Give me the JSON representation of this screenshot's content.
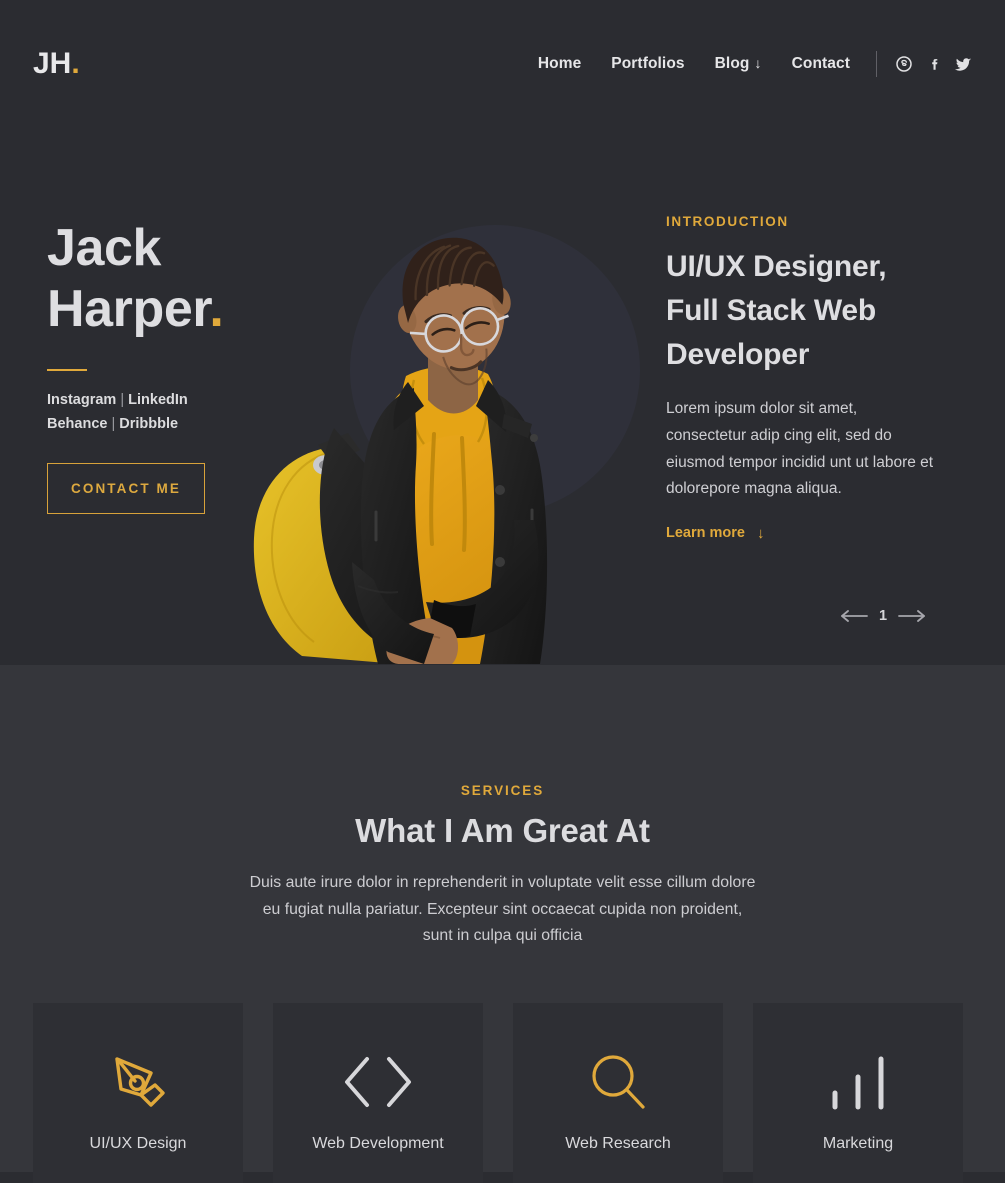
{
  "colors": {
    "accent": "#e0a93b",
    "hero_bg": "#2b2c31",
    "services_bg": "#35363b",
    "card_bg": "#2e2f34",
    "text_light": "#dedee1",
    "text_muted": "#cfcfd3"
  },
  "navbar": {
    "logo_text": "JH",
    "logo_dot": ".",
    "links": [
      {
        "label": "Home",
        "caret": ""
      },
      {
        "label": "Portfolios",
        "caret": ""
      },
      {
        "label": "Blog",
        "caret": "↓"
      },
      {
        "label": "Contact",
        "caret": ""
      }
    ],
    "social": [
      {
        "name": "skype-icon",
        "title": "Skype"
      },
      {
        "name": "facebook-icon",
        "title": "Facebook"
      },
      {
        "name": "twitter-icon",
        "title": "Twitter"
      }
    ]
  },
  "hero": {
    "name_line1": "Jack",
    "name_line2": "Harper",
    "name_dot": ".",
    "social_line1": "Instagram",
    "social_sep1": " | ",
    "social_line1b": "LinkedIn",
    "social_line2": "Behance",
    "social_sep2": " | ",
    "social_line2b": "Dribbble",
    "contact_button": "CONTACT ME",
    "eyebrow": "INTRODUCTION",
    "title": "UI/UX Designer, Full Stack Web Developer",
    "description": "Lorem ipsum dolor sit amet, consectetur adip cing elit, sed do eiusmod tempor incidid unt ut labore et dolorepore magna aliqua.",
    "learn_more": "Learn more",
    "learn_more_arrow": "↓",
    "slide_index": "1"
  },
  "services": {
    "eyebrow": "SERVICES",
    "title": "What I Am Great At",
    "description": "Duis aute irure dolor in reprehenderit in voluptate velit esse cillum dolore eu fugiat nulla pariatur. Excepteur sint occaecat cupida non proident, sunt in culpa qui officia",
    "cards": [
      {
        "label": "UI/UX Design",
        "icon": "pen-tool-icon",
        "icon_color": "#e0a93b"
      },
      {
        "label": "Web Development",
        "icon": "code-icon",
        "icon_color": "#d7d7da"
      },
      {
        "label": "Web Research",
        "icon": "magnifier-icon",
        "icon_color": "#e0a93b"
      },
      {
        "label": "Marketing",
        "icon": "bar-chart-icon",
        "icon_color": "#d7d7da"
      }
    ]
  }
}
